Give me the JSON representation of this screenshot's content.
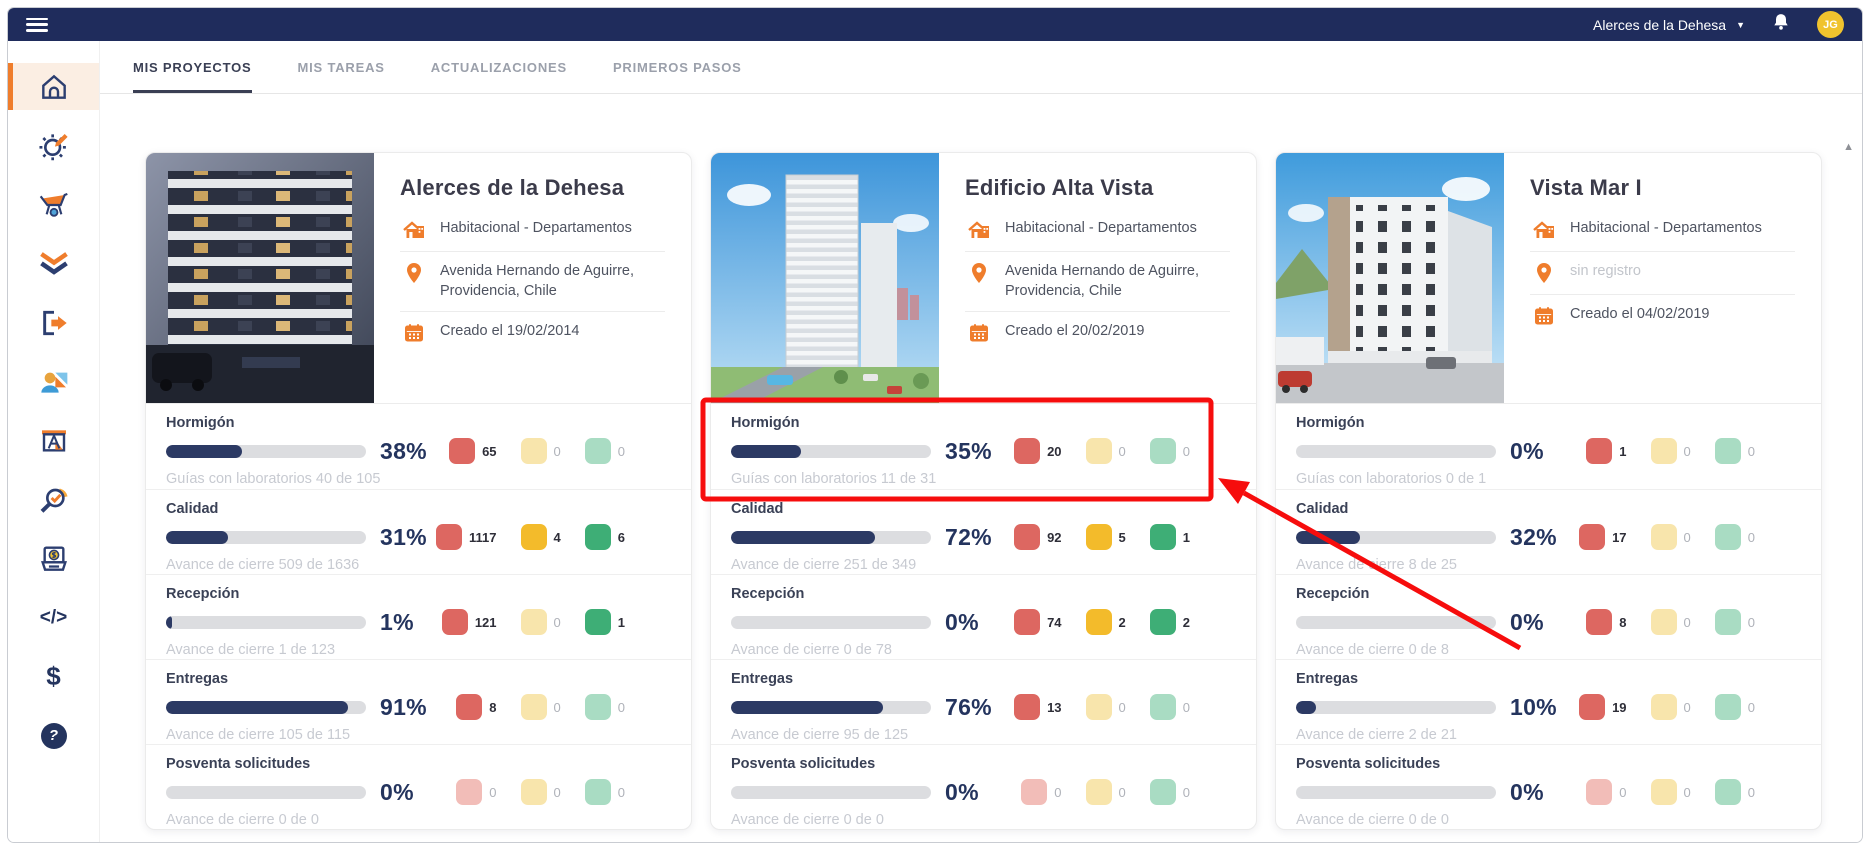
{
  "topbar": {
    "account_name": "Alerces de la Dehesa",
    "avatar_initials": "JG"
  },
  "icons": {
    "caret_glyph": "▼",
    "code_glyph": "</>",
    "dollar_glyph": "$",
    "help_glyph": "?",
    "scroll_up_glyph": "▲"
  },
  "tabs": [
    {
      "label": "MIS PROYECTOS",
      "active": true
    },
    {
      "label": "MIS TAREAS",
      "active": false
    },
    {
      "label": "ACTUALIZACIONES",
      "active": false
    },
    {
      "label": "PRIMEROS PASOS",
      "active": false
    }
  ],
  "sidebar": {
    "items": [
      {
        "icon": "home-icon",
        "active": true
      },
      {
        "icon": "settings-gear-icon",
        "active": false
      },
      {
        "icon": "wheelbarrow-icon",
        "active": false
      },
      {
        "icon": "double-check-icon",
        "active": false
      },
      {
        "icon": "door-arrow-icon",
        "active": false
      },
      {
        "icon": "users-icon",
        "active": false
      },
      {
        "icon": "drafting-board-icon",
        "active": false
      },
      {
        "icon": "inspection-magnifier-icon",
        "active": false
      },
      {
        "icon": "billing-laptop-icon",
        "active": false
      },
      {
        "icon": "code-icon",
        "active": false
      },
      {
        "icon": "dollar-icon",
        "active": false
      },
      {
        "icon": "help-icon",
        "active": false
      }
    ]
  },
  "projects": [
    {
      "title": "Alerces de la Dehesa",
      "type": "Habitacional - Departamentos",
      "address": "Avenida Hernando de Aguirre, Providencia, Chile",
      "address_muted": false,
      "created": "Creado el 19/02/2014",
      "stats": [
        {
          "label": "Hormigón",
          "percent": "38%",
          "fill": 38,
          "subtitle": "Guías con laboratorios 40 de 105",
          "badges": [
            {
              "color": "red",
              "solid": true,
              "value": "65"
            },
            {
              "color": "yellow",
              "solid": false,
              "value": "0"
            },
            {
              "color": "green",
              "solid": false,
              "value": "0"
            }
          ]
        },
        {
          "label": "Calidad",
          "percent": "31%",
          "fill": 31,
          "subtitle": "Avance de cierre 509 de 1636",
          "badges": [
            {
              "color": "red",
              "solid": true,
              "value": "1117"
            },
            {
              "color": "yellow",
              "solid": true,
              "value": "4"
            },
            {
              "color": "green",
              "solid": true,
              "value": "6"
            }
          ]
        },
        {
          "label": "Recepción",
          "percent": "1%",
          "fill": 1,
          "subtitle": "Avance de cierre 1 de 123",
          "badges": [
            {
              "color": "red",
              "solid": true,
              "value": "121"
            },
            {
              "color": "yellow",
              "solid": false,
              "value": "0"
            },
            {
              "color": "green",
              "solid": true,
              "value": "1"
            }
          ]
        },
        {
          "label": "Entregas",
          "percent": "91%",
          "fill": 91,
          "subtitle": "Avance de cierre 105 de 115",
          "badges": [
            {
              "color": "red",
              "solid": true,
              "value": "8"
            },
            {
              "color": "yellow",
              "solid": false,
              "value": "0"
            },
            {
              "color": "green",
              "solid": false,
              "value": "0"
            }
          ]
        },
        {
          "label": "Posventa solicitudes",
          "percent": "0%",
          "fill": 0,
          "subtitle": "Avance de cierre 0 de 0",
          "badges": [
            {
              "color": "red",
              "solid": false,
              "value": "0"
            },
            {
              "color": "yellow",
              "solid": false,
              "value": "0"
            },
            {
              "color": "green",
              "solid": false,
              "value": "0"
            }
          ]
        }
      ]
    },
    {
      "title": "Edificio Alta Vista",
      "type": "Habitacional - Departamentos",
      "address": "Avenida Hernando de Aguirre, Providencia, Chile",
      "address_muted": false,
      "created": "Creado el 20/02/2019",
      "stats": [
        {
          "label": "Hormigón",
          "percent": "35%",
          "fill": 35,
          "subtitle": "Guías con laboratorios 11 de 31",
          "badges": [
            {
              "color": "red",
              "solid": true,
              "value": "20"
            },
            {
              "color": "yellow",
              "solid": false,
              "value": "0"
            },
            {
              "color": "green",
              "solid": false,
              "value": "0"
            }
          ]
        },
        {
          "label": "Calidad",
          "percent": "72%",
          "fill": 72,
          "subtitle": "Avance de cierre 251 de 349",
          "badges": [
            {
              "color": "red",
              "solid": true,
              "value": "92"
            },
            {
              "color": "yellow",
              "solid": true,
              "value": "5"
            },
            {
              "color": "green",
              "solid": true,
              "value": "1"
            }
          ]
        },
        {
          "label": "Recepción",
          "percent": "0%",
          "fill": 0,
          "subtitle": "Avance de cierre 0 de 78",
          "badges": [
            {
              "color": "red",
              "solid": true,
              "value": "74"
            },
            {
              "color": "yellow",
              "solid": true,
              "value": "2"
            },
            {
              "color": "green",
              "solid": true,
              "value": "2"
            }
          ]
        },
        {
          "label": "Entregas",
          "percent": "76%",
          "fill": 76,
          "subtitle": "Avance de cierre 95 de 125",
          "badges": [
            {
              "color": "red",
              "solid": true,
              "value": "13"
            },
            {
              "color": "yellow",
              "solid": false,
              "value": "0"
            },
            {
              "color": "green",
              "solid": false,
              "value": "0"
            }
          ]
        },
        {
          "label": "Posventa solicitudes",
          "percent": "0%",
          "fill": 0,
          "subtitle": "Avance de cierre 0 de 0",
          "badges": [
            {
              "color": "red",
              "solid": false,
              "value": "0"
            },
            {
              "color": "yellow",
              "solid": false,
              "value": "0"
            },
            {
              "color": "green",
              "solid": false,
              "value": "0"
            }
          ]
        }
      ]
    },
    {
      "title": "Vista Mar I",
      "type": "Habitacional - Departamentos",
      "address": "sin registro",
      "address_muted": true,
      "created": "Creado el 04/02/2019",
      "stats": [
        {
          "label": "Hormigón",
          "percent": "0%",
          "fill": 0,
          "subtitle": "Guías con laboratorios 0 de 1",
          "badges": [
            {
              "color": "red",
              "solid": true,
              "value": "1"
            },
            {
              "color": "yellow",
              "solid": false,
              "value": "0"
            },
            {
              "color": "green",
              "solid": false,
              "value": "0"
            }
          ]
        },
        {
          "label": "Calidad",
          "percent": "32%",
          "fill": 32,
          "subtitle": "Avance de cierre 8 de 25",
          "badges": [
            {
              "color": "red",
              "solid": true,
              "value": "17"
            },
            {
              "color": "yellow",
              "solid": false,
              "value": "0"
            },
            {
              "color": "green",
              "solid": false,
              "value": "0"
            }
          ]
        },
        {
          "label": "Recepción",
          "percent": "0%",
          "fill": 0,
          "subtitle": "Avance de cierre 0 de 8",
          "badges": [
            {
              "color": "red",
              "solid": true,
              "value": "8"
            },
            {
              "color": "yellow",
              "solid": false,
              "value": "0"
            },
            {
              "color": "green",
              "solid": false,
              "value": "0"
            }
          ]
        },
        {
          "label": "Entregas",
          "percent": "10%",
          "fill": 10,
          "subtitle": "Avance de cierre 2 de 21",
          "badges": [
            {
              "color": "red",
              "solid": true,
              "value": "19"
            },
            {
              "color": "yellow",
              "solid": false,
              "value": "0"
            },
            {
              "color": "green",
              "solid": false,
              "value": "0"
            }
          ]
        },
        {
          "label": "Posventa solicitudes",
          "percent": "0%",
          "fill": 0,
          "subtitle": "Avance de cierre 0 de 0",
          "badges": [
            {
              "color": "red",
              "solid": false,
              "value": "0"
            },
            {
              "color": "yellow",
              "solid": false,
              "value": "0"
            },
            {
              "color": "green",
              "solid": false,
              "value": "0"
            }
          ]
        }
      ]
    }
  ],
  "annotation": {
    "shape": "box-and-arrow",
    "color": "#F60D0D"
  },
  "colors": {
    "topbar": "#1F2C5C",
    "accent_orange": "#EF7D2C",
    "progress_fill": "#2C3A64",
    "badge_red": "#DD6761",
    "badge_yellow": "#F3BB2B",
    "badge_green": "#3EAE76",
    "avatar_bg": "#F0C32E",
    "active_item_bg": "#FBEEE3"
  }
}
